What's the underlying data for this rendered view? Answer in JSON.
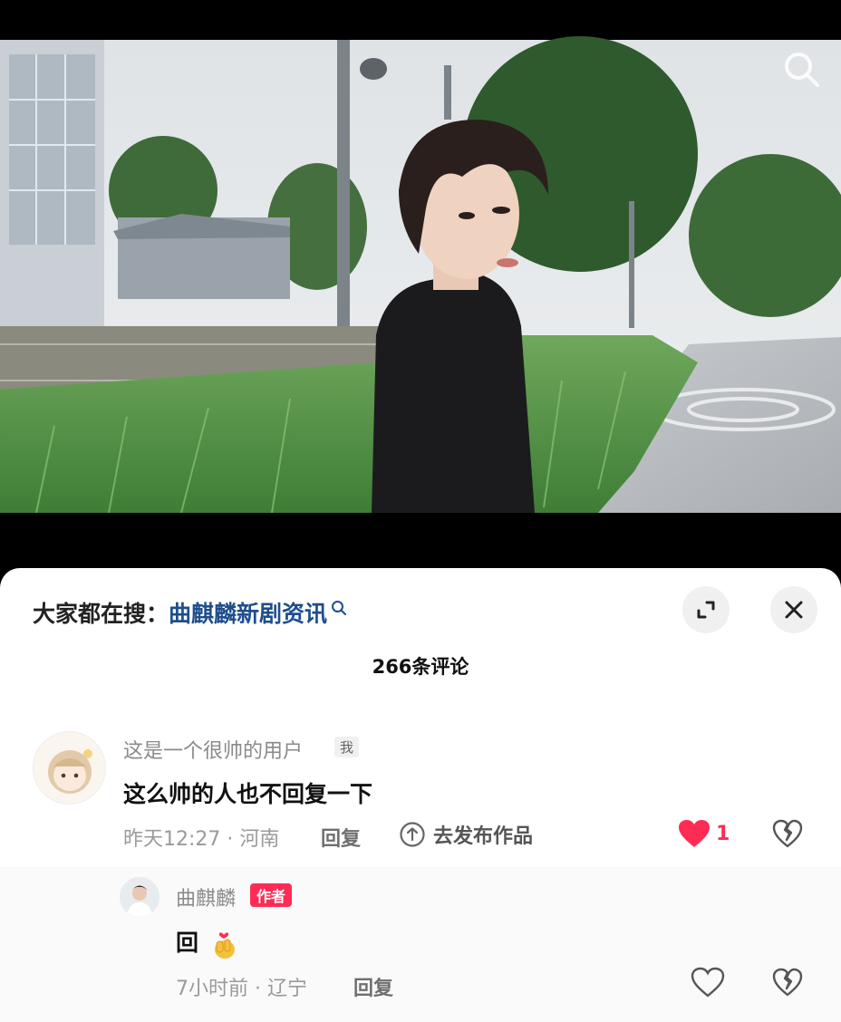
{
  "header": {
    "hot_search_label": "大家都在搜：",
    "hot_search_keyword": "曲麒麟新剧资讯"
  },
  "comment_count_label": "266条评论",
  "comments": [
    {
      "username": "这是一个很帅的用户",
      "badge": "我",
      "text": "这么帅的人也不回复一下",
      "time_location": "昨天12:27 · 河南",
      "reply_label": "回复",
      "publish_label": "去发布作品",
      "like_count": "1",
      "liked": true
    }
  ],
  "replies": [
    {
      "username": "曲麒麟",
      "badge": "作者",
      "text": "回",
      "emoji": "🫰",
      "time_location": "7小时前 · 辽宁",
      "reply_label": "回复"
    }
  ],
  "colors": {
    "accent": "#fe2c55",
    "link": "#1f4e8c"
  },
  "icons": [
    "search-icon",
    "expand-icon",
    "close-icon",
    "heart-icon",
    "dislike-icon",
    "arrow-up-circle-icon"
  ]
}
